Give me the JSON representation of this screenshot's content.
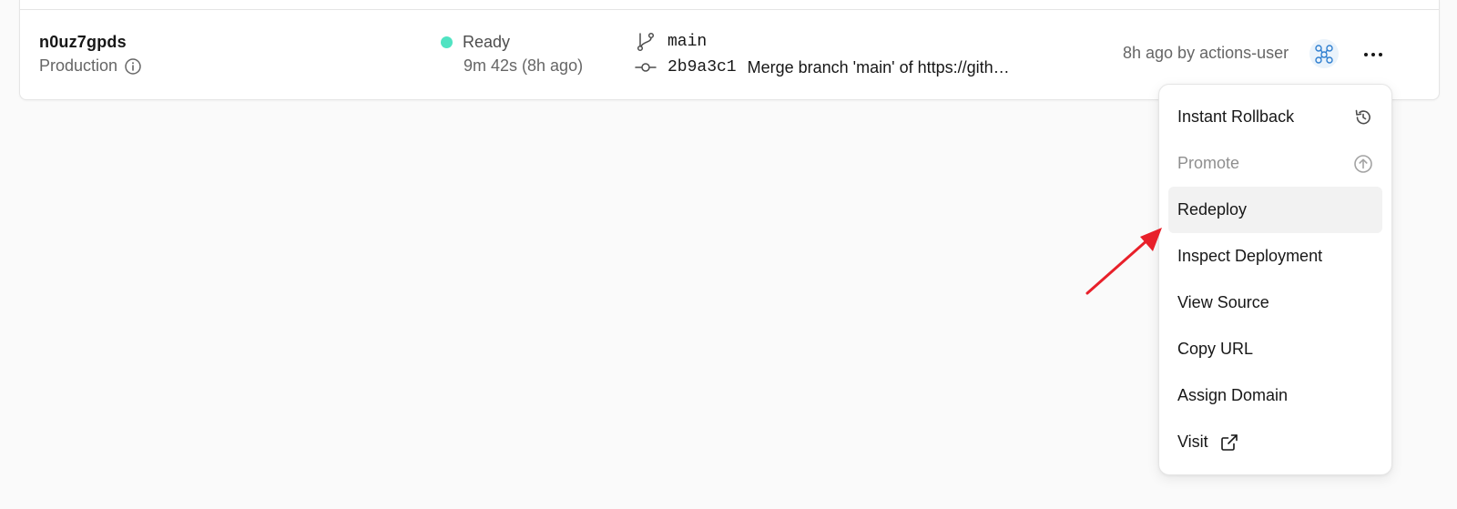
{
  "deployment": {
    "id": "n0uz7gpds",
    "environment": "Production",
    "status": "Ready",
    "status_color": "#50e3c2",
    "duration": "9m 42s (8h ago)",
    "branch": "main",
    "commit_hash": "2b9a3c1",
    "commit_message": "Merge branch 'main' of https://gith…",
    "meta": "8h ago by actions-user"
  },
  "menu": {
    "items": [
      {
        "label": "Instant Rollback",
        "icon": "rollback-icon",
        "state": "normal"
      },
      {
        "label": "Promote",
        "icon": "promote-icon",
        "state": "disabled"
      },
      {
        "label": "Redeploy",
        "icon": "",
        "state": "hovered"
      },
      {
        "label": "Inspect Deployment",
        "icon": "",
        "state": "normal"
      },
      {
        "label": "View Source",
        "icon": "",
        "state": "normal"
      },
      {
        "label": "Copy URL",
        "icon": "",
        "state": "normal"
      },
      {
        "label": "Assign Domain",
        "icon": "",
        "state": "normal"
      },
      {
        "label": "Visit",
        "icon": "external-link-icon",
        "state": "normal"
      }
    ]
  },
  "colors": {
    "annotation_arrow": "#e8202a",
    "menu_hover_bg": "#f2f2f2",
    "muted_text": "#666666"
  }
}
